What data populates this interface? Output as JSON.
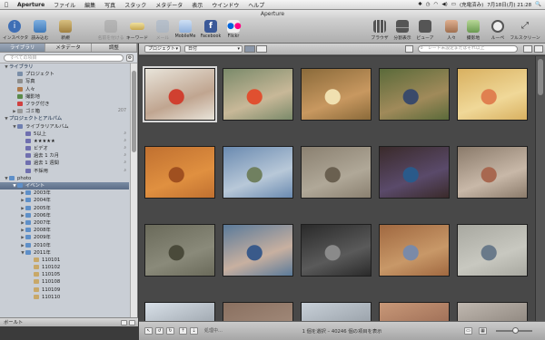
{
  "menubar": {
    "items": [
      "Aperture",
      "ファイル",
      "編集",
      "写真",
      "スタック",
      "メタデータ",
      "表示",
      "ウインドウ",
      "ヘルプ"
    ],
    "status": {
      "battery": "(充電済み)",
      "datetime": "7月18日(月) 21:28"
    }
  },
  "window": {
    "title": "Aperture"
  },
  "toolbar": {
    "inspector": "インスペクタ",
    "import": "読み込む",
    "new": "新規",
    "stack": "名前を付ける",
    "keyword": "キーワード",
    "mail": "メール",
    "mobileme": "MobileMe",
    "facebook": "Facebook",
    "flickr": "Flickr",
    "browser": "ブラウザ",
    "split": "分割表示",
    "viewer": "ビューア",
    "faces": "人々",
    "places": "撮影地",
    "loupe": "ルーペ",
    "fullscreen": "フルスクリーン"
  },
  "left_panel": {
    "tabs": [
      "ライブラリ",
      "メタデータ",
      "調整"
    ],
    "search_placeholder": "すべての項目",
    "tree": [
      {
        "label": "ライブラリ",
        "type": "header",
        "indent": 0,
        "tri": "▼"
      },
      {
        "label": "プロジェクト",
        "indent": 1,
        "icon": "#7a8ea8"
      },
      {
        "label": "写真",
        "indent": 1,
        "icon": "#8e8e8e"
      },
      {
        "label": "人々",
        "indent": 1,
        "icon": "#b07a4a"
      },
      {
        "label": "撮影地",
        "indent": 1,
        "icon": "#5a8a4a"
      },
      {
        "label": "フラグ付き",
        "indent": 1,
        "icon": "#d04040"
      },
      {
        "label": "ゴミ箱",
        "indent": 1,
        "icon": "#999999",
        "count": "207",
        "tri": "▶"
      },
      {
        "label": "プロジェクトとアルバム",
        "type": "header",
        "indent": 0,
        "tri": "▼"
      },
      {
        "label": "ライブラリアルバム",
        "indent": 1,
        "icon": "#6f7fb0",
        "tri": "▼"
      },
      {
        "label": "5以上",
        "indent": 2,
        "icon": "#6f6faf",
        "mag": "🔍"
      },
      {
        "label": "★★★★★",
        "indent": 2,
        "icon": "#6f6faf",
        "mag": "🔍"
      },
      {
        "label": "ビデオ",
        "indent": 2,
        "icon": "#6f6faf",
        "mag": "🔍"
      },
      {
        "label": "過去 1 カ月",
        "indent": 2,
        "icon": "#6f6faf",
        "mag": "🔍"
      },
      {
        "label": "過去 1 週間",
        "indent": 2,
        "icon": "#6f6faf",
        "mag": "🔍"
      },
      {
        "label": "不採用",
        "indent": 2,
        "icon": "#6f6faf",
        "mag": "🔍"
      },
      {
        "label": "photo",
        "indent": 0,
        "icon": "#5e8fc8",
        "tri": "▼"
      },
      {
        "label": "イベント",
        "indent": 1,
        "icon": "#5e8fc8",
        "tri": "▼",
        "selected": true
      },
      {
        "label": "2003年",
        "indent": 2,
        "icon": "#5e8fc8",
        "tri": "▶"
      },
      {
        "label": "2004年",
        "indent": 2,
        "icon": "#5e8fc8",
        "tri": "▶"
      },
      {
        "label": "2005年",
        "indent": 2,
        "icon": "#5e8fc8",
        "tri": "▶"
      },
      {
        "label": "2006年",
        "indent": 2,
        "icon": "#5e8fc8",
        "tri": "▶"
      },
      {
        "label": "2007年",
        "indent": 2,
        "icon": "#5e8fc8",
        "tri": "▶"
      },
      {
        "label": "2008年",
        "indent": 2,
        "icon": "#5e8fc8",
        "tri": "▶"
      },
      {
        "label": "2009年",
        "indent": 2,
        "icon": "#5e8fc8",
        "tri": "▶"
      },
      {
        "label": "2010年",
        "indent": 2,
        "icon": "#5e8fc8",
        "tri": "▶"
      },
      {
        "label": "2011年",
        "indent": 2,
        "icon": "#5e8fc8",
        "tri": "▼"
      },
      {
        "label": "110101",
        "indent": 3,
        "icon": "#c8a868"
      },
      {
        "label": "110102",
        "indent": 3,
        "icon": "#c8a868"
      },
      {
        "label": "110105",
        "indent": 3,
        "icon": "#c8a868"
      },
      {
        "label": "110108",
        "indent": 3,
        "icon": "#c8a868"
      },
      {
        "label": "110109",
        "indent": 3,
        "icon": "#c8a868"
      },
      {
        "label": "110110",
        "indent": 3,
        "icon": "#c8a868"
      }
    ],
    "bottom_label": "ボールト"
  },
  "browser": {
    "project_popup": "プロジェクト",
    "sort_popup": "日付",
    "search_placeholder": "レート未設定またはそれ以上",
    "status_text": "1 個を選択 – 40246 個の項目を表示",
    "rotate_label": "処理中…"
  },
  "thumbnails": [
    {
      "colors": [
        "#e8e4da",
        "#c0a590",
        "#d04030"
      ],
      "selected": true
    },
    {
      "colors": [
        "#7a8a6a",
        "#c8b898",
        "#e05030"
      ]
    },
    {
      "colors": [
        "#8a6a3a",
        "#c89860",
        "#f0e0b0"
      ]
    },
    {
      "colors": [
        "#5a6a3a",
        "#a08a5a",
        "#3a4a6a"
      ]
    },
    {
      "colors": [
        "#d8b060",
        "#f0d898",
        "#e08050"
      ]
    },
    {
      "colors": [
        "#c07030",
        "#e09040",
        "#a05020"
      ]
    },
    {
      "colors": [
        "#6a8ab0",
        "#b8c8d8",
        "#708060"
      ]
    },
    {
      "colors": [
        "#8a8070",
        "#b0a898",
        "#6a6050"
      ]
    },
    {
      "colors": [
        "#3a2a2a",
        "#5a4a6a",
        "#2a5a8a"
      ]
    },
    {
      "colors": [
        "#8a7a6a",
        "#c8b8a8",
        "#a86850"
      ]
    },
    {
      "colors": [
        "#6a6a5a",
        "#8a8a7a",
        "#4a4a3a"
      ]
    },
    {
      "colors": [
        "#5a7a9a",
        "#c8b0a0",
        "#3a5a8a"
      ]
    },
    {
      "colors": [
        "#2a2a2a",
        "#5a5a5a",
        "#8a8a8a"
      ]
    },
    {
      "colors": [
        "#a06840",
        "#c89868",
        "#7a8aa8"
      ]
    },
    {
      "colors": [
        "#a8a8a0",
        "#c8c8c0",
        "#6a7a8a"
      ]
    },
    {
      "colors": [
        "#d8e0e8",
        "#a0a8b0",
        "#707880"
      ]
    },
    {
      "colors": [
        "#8a7060",
        "#a08878",
        "#6a5848"
      ]
    },
    {
      "colors": [
        "#c8d0d8",
        "#9aa2aa",
        "#707070"
      ]
    },
    {
      "colors": [
        "#c89878",
        "#a07058",
        "#6a4a3a"
      ]
    },
    {
      "colors": [
        "#c0b8b0",
        "#908880",
        "#605850"
      ]
    }
  ],
  "colors": {
    "accent": "#5b6d87",
    "grid_bg": "#484848"
  }
}
